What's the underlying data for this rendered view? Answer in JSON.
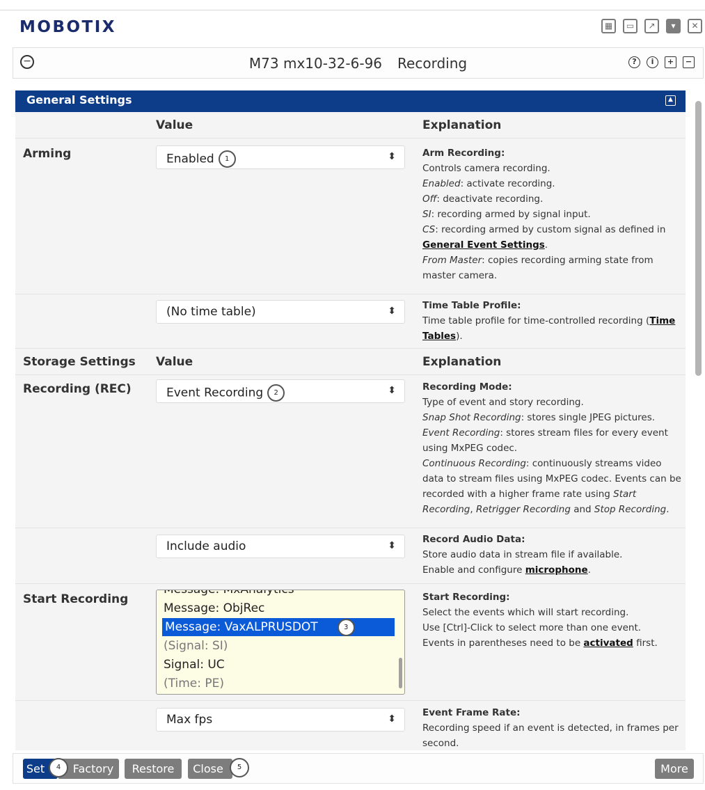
{
  "app": {
    "logo": "MOBOTIX"
  },
  "window_icons": [
    "grid-icon",
    "minimize-icon",
    "popout-icon",
    "dropdown-icon",
    "close-icon"
  ],
  "titlebar": {
    "camera": "M73 mx10-32-6-96",
    "page": "Recording",
    "icons": [
      "help-icon",
      "info-icon",
      "expand-all-icon",
      "collapse-all-icon"
    ]
  },
  "section": {
    "title": "General Settings"
  },
  "columns": {
    "value": "Value",
    "explanation": "Explanation",
    "storage_settings": "Storage Settings"
  },
  "rows": {
    "arming": {
      "label": "Arming",
      "value": "Enabled",
      "badge": "1",
      "expl_title": "Arm Recording",
      "expl_1": "Controls camera recording.",
      "expl_enabled_term": "Enabled",
      "expl_enabled": ": activate recording.",
      "expl_off_term": "Off",
      "expl_off": ": deactivate recording.",
      "expl_si_term": "SI",
      "expl_si": ": recording armed by signal input.",
      "expl_cs_term": "CS",
      "expl_cs": ": recording armed by custom signal as defined in",
      "expl_link": "General Event Settings",
      "expl_master_term": "From Master",
      "expl_master": ": copies recording arming state from master camera."
    },
    "time_table": {
      "value": "(No time table)",
      "expl_title": "Time Table Profile",
      "expl_1": "Time table profile for time-controlled recording (",
      "expl_link": "Time Tables",
      "expl_2": ")."
    },
    "recording": {
      "label": "Recording (REC)",
      "value": "Event Recording",
      "badge": "2",
      "expl_title": "Recording Mode",
      "expl_1": "Type of event and story recording.",
      "expl_snap_term": "Snap Shot Recording",
      "expl_snap": ": stores single JPEG pictures.",
      "expl_event_term": "Event Recording",
      "expl_event": ": stores stream files for every event using MxPEG codec.",
      "expl_cont_term": "Continuous Recording",
      "expl_cont": ": continuously streams video data to stream files using MxPEG codec. Events can be recorded with a higher frame rate using ",
      "expl_start_term": "Start Recording",
      "expl_comma": ", ",
      "expl_retrig_term": "Retrigger Recording",
      "expl_and": " and ",
      "expl_stop_term": "Stop Recording",
      "expl_end": "."
    },
    "audio": {
      "value": "Include audio",
      "expl_title": "Record Audio Data",
      "expl_1": "Store audio data in stream file if available.",
      "expl_2": "Enable and configure ",
      "expl_link": "microphone",
      "expl_3": "."
    },
    "start_recording": {
      "label": "Start Recording",
      "options": [
        "Message: MxAnalytics",
        "Message: ObjRec",
        "Message: VaxALPRUSDOT",
        "(Signal: SI)",
        "Signal: UC",
        "(Time: PE)"
      ],
      "selected": "Message: VaxALPRUSDOT",
      "badge": "3",
      "expl_title": "Start Recording",
      "expl_1": "Select the events which will start recording.",
      "expl_2": "Use [Ctrl]-Click to select more than one event.",
      "expl_3": "Events in parentheses need to be ",
      "expl_link": "activated",
      "expl_4": " first."
    },
    "frame_rate": {
      "value": "Max fps",
      "expl_title": "Event Frame Rate",
      "expl_1": "Recording speed if an event is detected, in frames per second."
    }
  },
  "footer": {
    "set": "Set",
    "factory": "Factory",
    "restore": "Restore",
    "close": "Close",
    "more": "More",
    "badge_set": "4",
    "badge_close": "5"
  },
  "colors": {
    "brand": "#1a2c6b",
    "section_bar": "#0d3c88",
    "selected": "#0b5bd8",
    "button_gray": "#7d7d7d"
  }
}
